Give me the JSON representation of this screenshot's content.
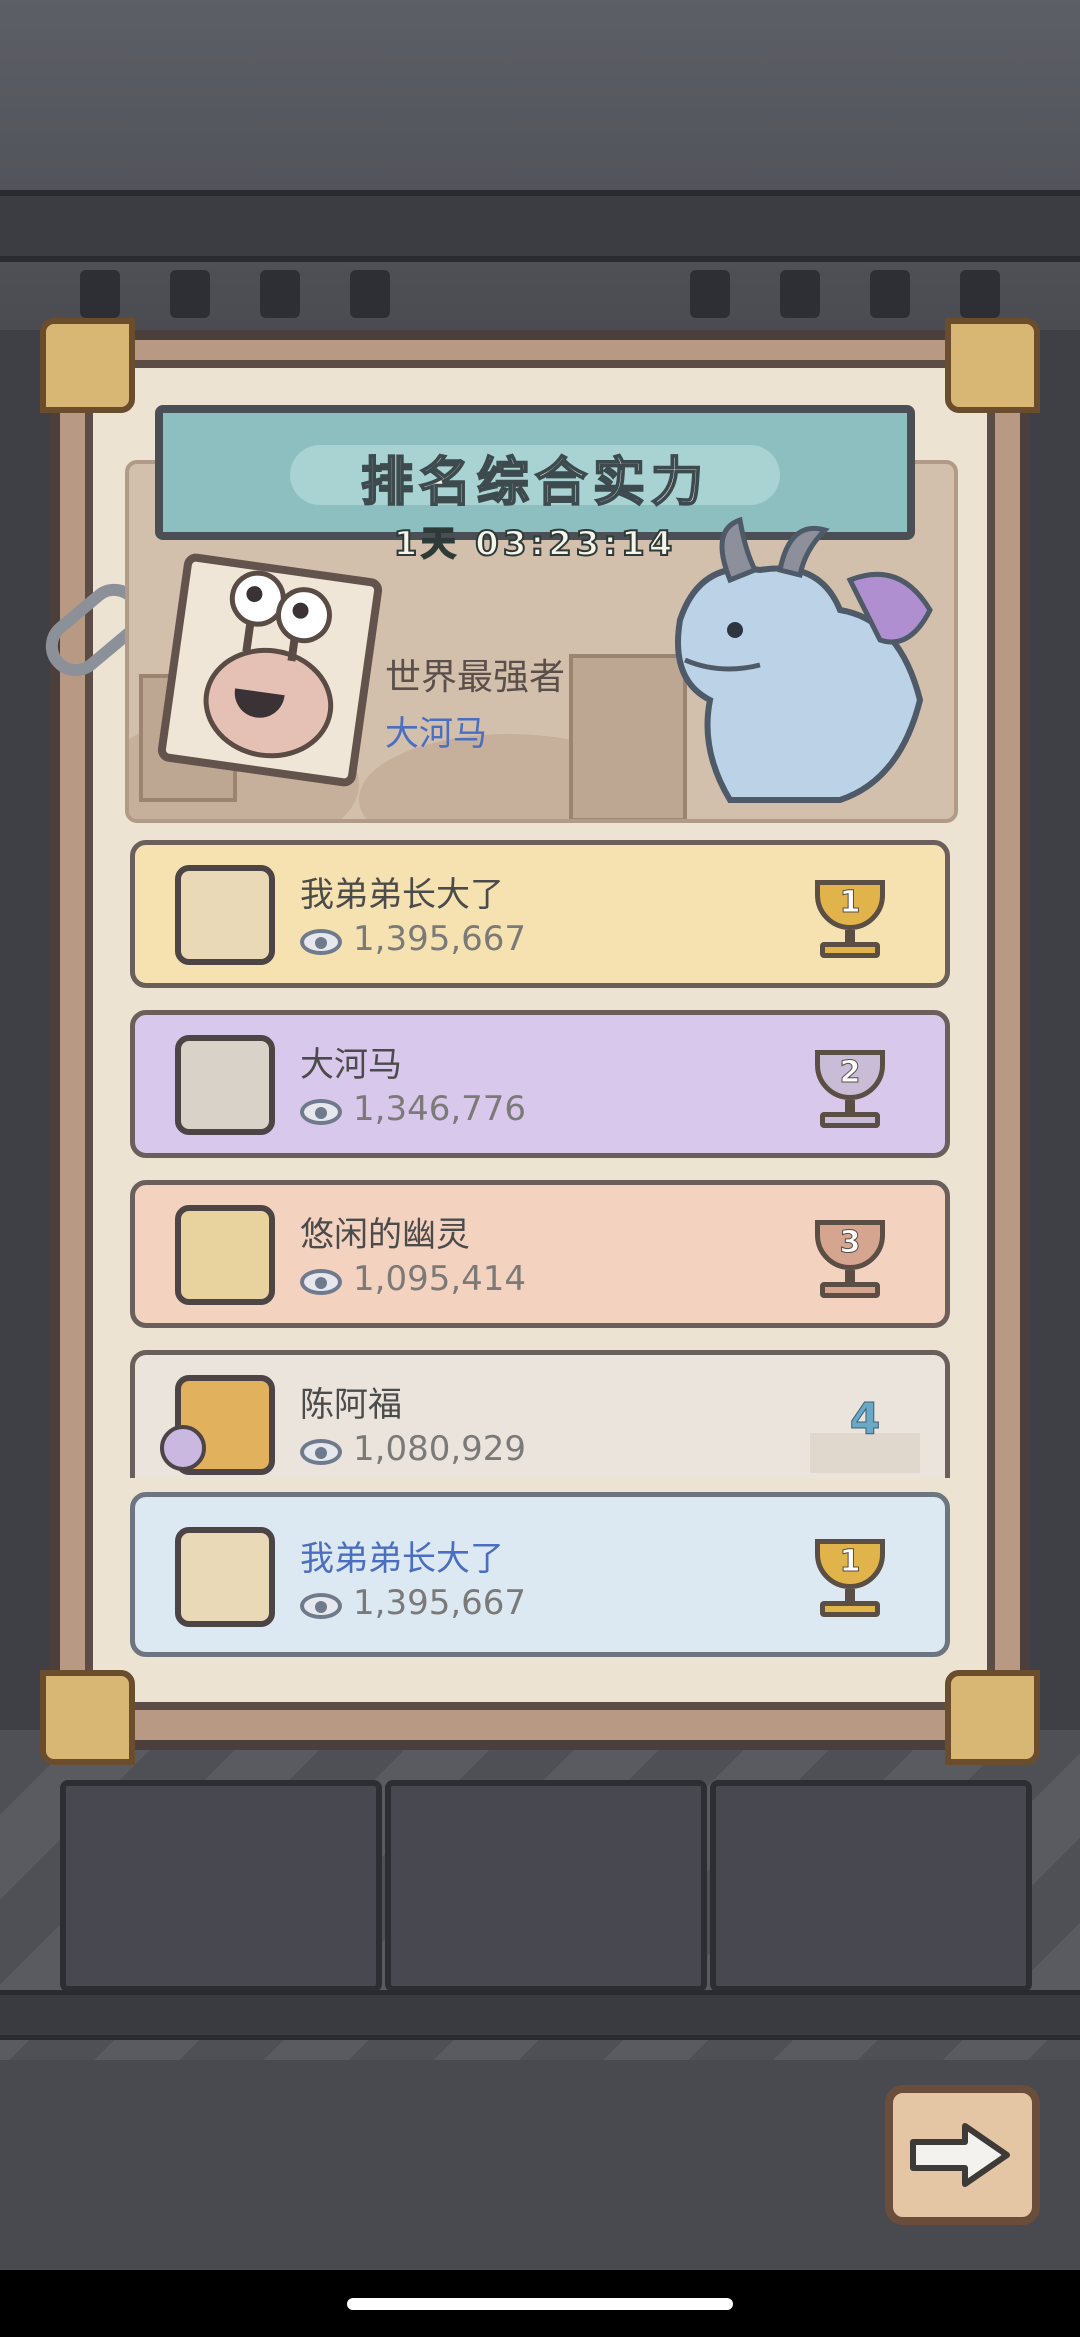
{
  "header": {
    "title": "排名综合实力",
    "countdown": "1天 03:23:14"
  },
  "champion": {
    "title": "世界最强者",
    "name": "大河马"
  },
  "rankings": [
    {
      "name": "我弟弟长大了",
      "score": "1,395,667",
      "rank": "1",
      "bg": "#f6e2b0"
    },
    {
      "name": "大河马",
      "score": "1,346,776",
      "rank": "2",
      "bg": "#d8c8ec"
    },
    {
      "name": "悠闲的幽灵",
      "score": "1,095,414",
      "rank": "3",
      "bg": "#f3d2c0"
    },
    {
      "name": "陈阿福",
      "score": "1,080,929",
      "rank": "4",
      "bg": "#ebe4dd"
    }
  ],
  "my_rank": {
    "name": "我弟弟长大了",
    "score": "1,395,667",
    "rank": "1"
  },
  "colors": {
    "gold": "#e0b34b",
    "silver": "#c9bcd7",
    "bronze": "#d6a590",
    "highlight_name": "#4a6fc0"
  },
  "icons": {
    "score": "eye-icon",
    "next": "arrow-right-icon"
  }
}
